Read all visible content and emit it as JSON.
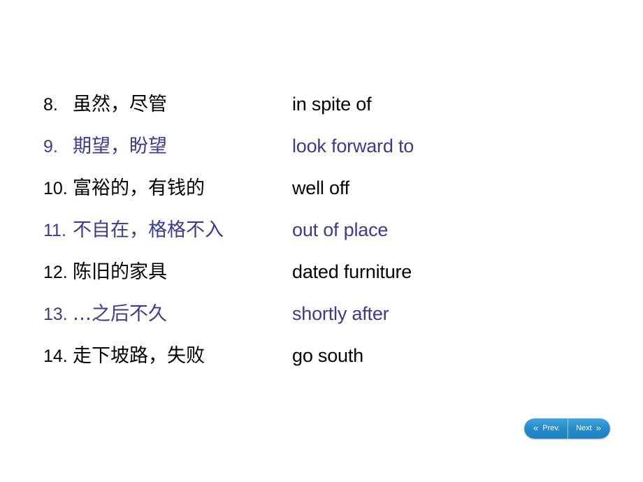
{
  "slide": {
    "background_color": "#ffffff",
    "text_color_dark": "#000000",
    "text_color_blue": "#3b3b8f"
  },
  "vocab_list": [
    {
      "number": "8.",
      "number_spaced": "8.  ",
      "chinese": "虽然，尽管",
      "english": "in spite of",
      "tone": "dark"
    },
    {
      "number": "9.",
      "number_spaced": "9.  ",
      "chinese": "期望，盼望",
      "english": "look forward to",
      "tone": "blue"
    },
    {
      "number": "10.",
      "number_spaced": "10.",
      "chinese": "富裕的，有钱的",
      "english": "well off",
      "tone": "dark"
    },
    {
      "number": "11.",
      "number_spaced": "11.",
      "chinese": "不自在，格格不入",
      "english": "out of place",
      "tone": "blue"
    },
    {
      "number": "12.",
      "number_spaced": "12.",
      "chinese": "陈旧的家具",
      "english": "dated furniture",
      "tone": "dark"
    },
    {
      "number": "13.",
      "number_spaced": "13.",
      "chinese": "…之后不久",
      "english": "shortly after",
      "tone": "blue"
    },
    {
      "number": "14.",
      "number_spaced": "14.",
      "chinese": "走下坡路，失败",
      "english": "go south",
      "tone": "dark"
    }
  ],
  "navigation": {
    "prev_label": "Prev.",
    "next_label": "Next",
    "prev_icon": "«",
    "next_icon": "»",
    "accent_color": "#2389c9"
  }
}
